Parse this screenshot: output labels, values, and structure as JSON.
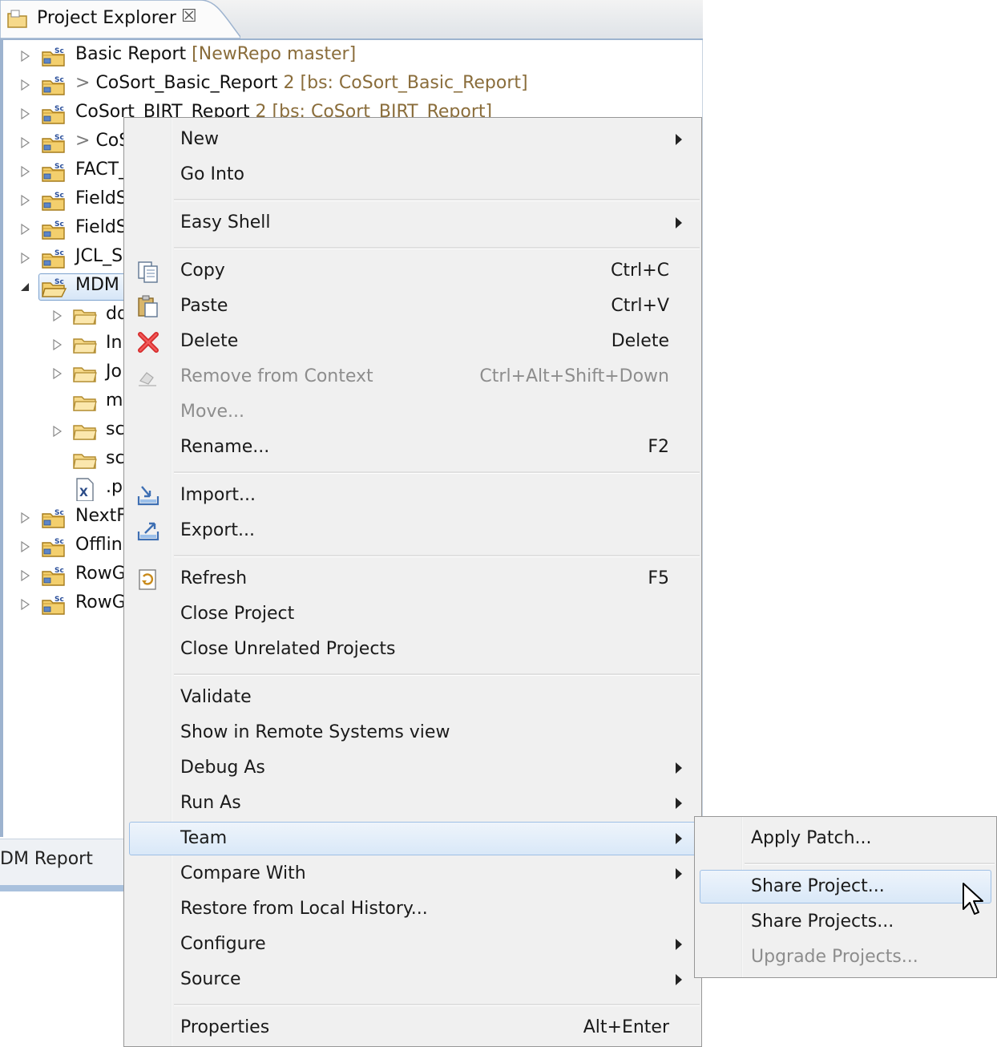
{
  "view": {
    "title": "Project Explorer",
    "close_glyph": "☒",
    "tab_icon": "folder-icon",
    "bottom_tab_title": "DM Report"
  },
  "tree": {
    "rows": [
      {
        "label": "Basic Report",
        "prefix": "",
        "decor": "[NewRepo master]",
        "icon": "project-icon",
        "expandable": true
      },
      {
        "label": "CoSort_Basic_Report",
        "prefix": "> ",
        "decor": "2 [bs: CoSort_Basic_Report]",
        "icon": "project-icon",
        "expandable": true
      },
      {
        "label": "CoSort_BIRT_Report",
        "prefix": "",
        "decor": "2 [bs: CoSort_BIRT_Report]",
        "icon": "project-icon",
        "expandable": true
      },
      {
        "label": "CoS",
        "prefix": "> ",
        "decor": "",
        "icon": "project-icon",
        "expandable": true
      },
      {
        "label": "FACT_",
        "prefix": "",
        "decor": "",
        "icon": "project-icon",
        "expandable": true
      },
      {
        "label": "FieldS",
        "prefix": "",
        "decor": "",
        "icon": "project-icon",
        "expandable": true
      },
      {
        "label": "FieldS",
        "prefix": "",
        "decor": "",
        "icon": "project-icon",
        "expandable": true
      },
      {
        "label": "JCL_SC",
        "prefix": "",
        "decor": "",
        "icon": "project-icon",
        "expandable": true
      },
      {
        "label": "MDM",
        "prefix": "",
        "decor": "",
        "icon": "open-project-icon",
        "expandable": true,
        "expanded": true,
        "selected": true
      },
      {
        "label": "dd",
        "prefix": "",
        "decor": "",
        "icon": "folder-icon",
        "expandable": true,
        "child": true
      },
      {
        "label": "Inp",
        "prefix": "",
        "decor": "",
        "icon": "folder-icon",
        "expandable": true,
        "child": true
      },
      {
        "label": "Jol",
        "prefix": "",
        "decor": "",
        "icon": "folder-icon",
        "expandable": true,
        "child": true
      },
      {
        "label": "me",
        "prefix": "",
        "decor": "",
        "icon": "folder-icon",
        "expandable": false,
        "child": true
      },
      {
        "label": "scl",
        "prefix": "",
        "decor": "",
        "icon": "folder-icon",
        "expandable": true,
        "child": true
      },
      {
        "label": "scr",
        "prefix": "",
        "decor": "",
        "icon": "folder-icon",
        "expandable": false,
        "child": true
      },
      {
        "label": ".pr",
        "prefix": "",
        "decor": "",
        "icon": "xml-file-icon",
        "expandable": false,
        "child": true
      },
      {
        "label": "NextF",
        "prefix": "",
        "decor": "",
        "icon": "project-icon",
        "expandable": true
      },
      {
        "label": "Offlin",
        "prefix": "",
        "decor": "",
        "icon": "project-icon",
        "expandable": true
      },
      {
        "label": "RowG",
        "prefix": "",
        "decor": "",
        "icon": "project-icon",
        "expandable": true
      },
      {
        "label": "RowG",
        "prefix": "",
        "decor": "",
        "icon": "project-icon",
        "expandable": true
      }
    ]
  },
  "menu": {
    "items": [
      {
        "label": "New",
        "submenu": true
      },
      {
        "label": "Go Into"
      },
      {
        "sep": true
      },
      {
        "label": "Easy Shell",
        "submenu": true
      },
      {
        "sep": true
      },
      {
        "label": "Copy",
        "shortcut": "Ctrl+C",
        "icon": "copy-icon"
      },
      {
        "label": "Paste",
        "shortcut": "Ctrl+V",
        "icon": "paste-icon"
      },
      {
        "label": "Delete",
        "shortcut": "Delete",
        "icon": "delete-icon"
      },
      {
        "label": "Remove from Context",
        "shortcut": "Ctrl+Alt+Shift+Down",
        "icon": "remove-context-icon",
        "disabled": true
      },
      {
        "label": "Move...",
        "disabled": true
      },
      {
        "label": "Rename...",
        "shortcut": "F2"
      },
      {
        "sep": true
      },
      {
        "label": "Import...",
        "icon": "import-icon"
      },
      {
        "label": "Export...",
        "icon": "export-icon"
      },
      {
        "sep": true
      },
      {
        "label": "Refresh",
        "shortcut": "F5",
        "icon": "refresh-icon"
      },
      {
        "label": "Close Project"
      },
      {
        "label": "Close Unrelated Projects"
      },
      {
        "sep": true
      },
      {
        "label": "Validate"
      },
      {
        "label": "Show in Remote Systems view"
      },
      {
        "label": "Debug As",
        "submenu": true
      },
      {
        "label": "Run As",
        "submenu": true
      },
      {
        "label": "Team",
        "submenu": true,
        "hover": true
      },
      {
        "label": "Compare With",
        "submenu": true
      },
      {
        "label": "Restore from Local History..."
      },
      {
        "label": "Configure",
        "submenu": true
      },
      {
        "label": "Source",
        "submenu": true
      },
      {
        "sep": true
      },
      {
        "label": "Properties",
        "shortcut": "Alt+Enter"
      }
    ]
  },
  "submenu": {
    "items": [
      {
        "label": "Apply Patch..."
      },
      {
        "sep": true
      },
      {
        "label": "Share Project...",
        "hover": true
      },
      {
        "label": "Share Projects..."
      },
      {
        "label": "Upgrade Projects...",
        "disabled": true
      }
    ]
  },
  "cursor": "arrow-cursor-icon"
}
